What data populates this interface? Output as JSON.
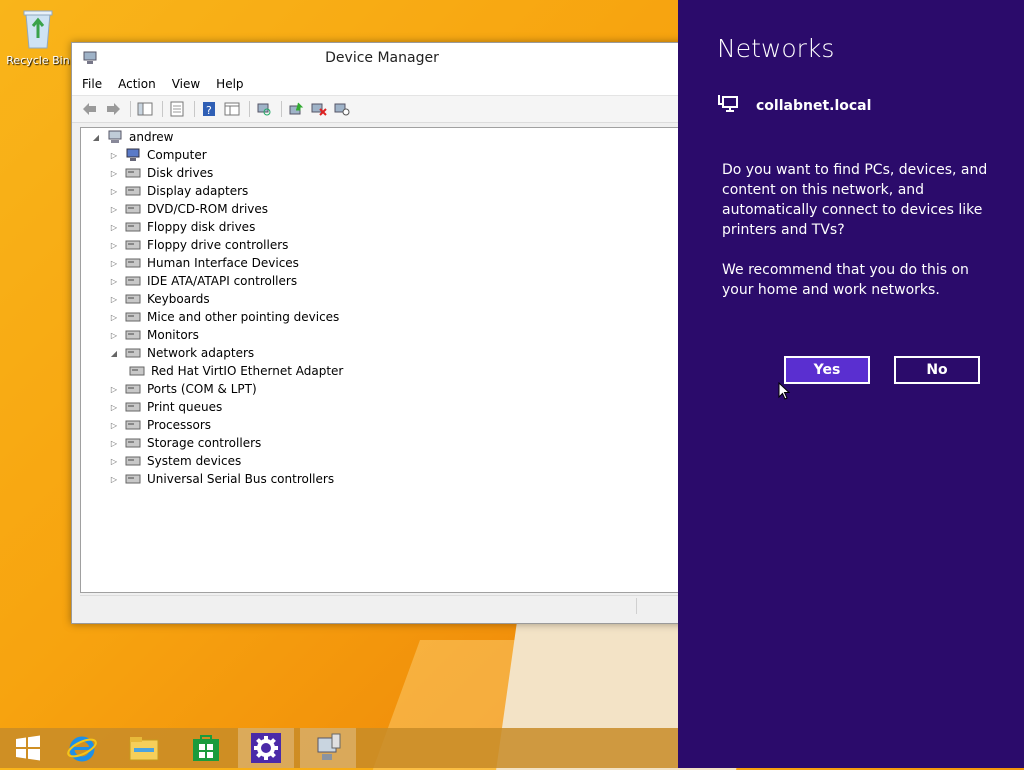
{
  "desktop": {
    "recycle_bin_label": "Recycle Bin"
  },
  "window": {
    "title": "Device Manager",
    "menu": [
      "File",
      "Action",
      "View",
      "Help"
    ],
    "tree": {
      "root": "andrew",
      "items": [
        {
          "label": "Computer",
          "expanded": false
        },
        {
          "label": "Disk drives",
          "expanded": false
        },
        {
          "label": "Display adapters",
          "expanded": false
        },
        {
          "label": "DVD/CD-ROM drives",
          "expanded": false
        },
        {
          "label": "Floppy disk drives",
          "expanded": false
        },
        {
          "label": "Floppy drive controllers",
          "expanded": false
        },
        {
          "label": "Human Interface Devices",
          "expanded": false
        },
        {
          "label": "IDE ATA/ATAPI controllers",
          "expanded": false
        },
        {
          "label": "Keyboards",
          "expanded": false
        },
        {
          "label": "Mice and other pointing devices",
          "expanded": false
        },
        {
          "label": "Monitors",
          "expanded": false
        },
        {
          "label": "Network adapters",
          "expanded": true
        },
        {
          "label": "Red Hat VirtIO Ethernet Adapter",
          "child": true
        },
        {
          "label": "Ports (COM & LPT)",
          "expanded": false
        },
        {
          "label": "Print queues",
          "expanded": false
        },
        {
          "label": "Processors",
          "expanded": false
        },
        {
          "label": "Storage controllers",
          "expanded": false
        },
        {
          "label": "System devices",
          "expanded": false
        },
        {
          "label": "Universal Serial Bus controllers",
          "expanded": false
        }
      ]
    }
  },
  "networks": {
    "heading": "Networks",
    "network_name": "collabnet.local",
    "question": "Do you want to find PCs, devices, and content on this network, and automatically connect to devices like printers and TVs?",
    "recommend": "We recommend that you do this on your home and work networks.",
    "yes_label": "Yes",
    "no_label": "No"
  },
  "colors": {
    "charm_bg": "#2b0b6b",
    "yes_bg": "#5a2fd0"
  },
  "taskbar": {
    "icons": [
      "start-icon",
      "internet-explorer-icon",
      "file-explorer-icon",
      "store-icon",
      "settings-icon",
      "device-manager-icon"
    ]
  }
}
